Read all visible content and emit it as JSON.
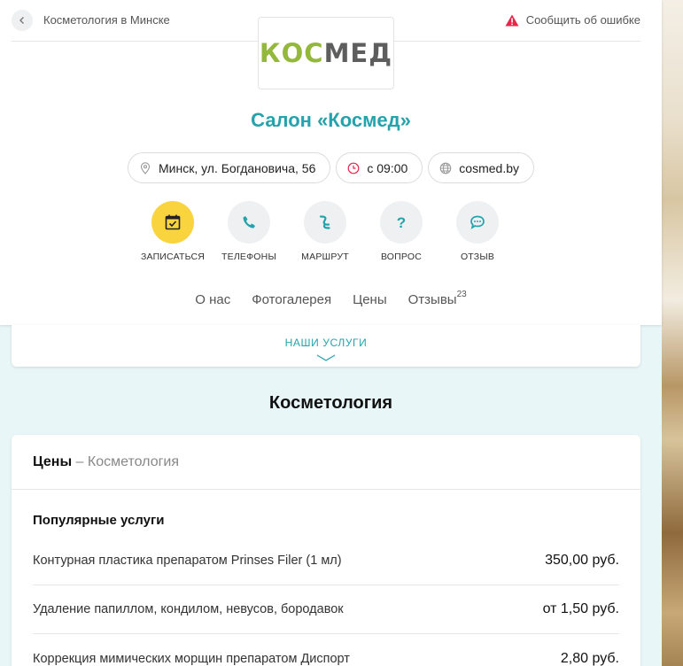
{
  "header": {
    "breadcrumb": "Косметология в Минске",
    "report_label": "Сообщить об ошибке"
  },
  "logo": {
    "part1": "КОС",
    "part2": "МЕД"
  },
  "salon": {
    "title": "Салон «Космед»"
  },
  "info_pills": {
    "address": "Минск, ул. Богдановича, 56",
    "hours": "с 09:00",
    "website": "cosmed.by"
  },
  "actions": {
    "book": "ЗАПИСАТЬСЯ",
    "phones": "ТЕЛЕФОНЫ",
    "route": "МАРШРУТ",
    "question": "ВОПРОС",
    "review": "ОТЗЫВ"
  },
  "tabs": {
    "about": "О нас",
    "gallery": "Фотогалерея",
    "prices": "Цены",
    "reviews": "Отзывы",
    "reviews_count": "23"
  },
  "services": {
    "label": "НАШИ УСЛУГИ"
  },
  "section": {
    "title": "Косметология"
  },
  "prices": {
    "head_bold": "Цены",
    "head_rest": " – Косметология",
    "popular_heading": "Популярные услуги",
    "rows": [
      {
        "name": "Контурная пластика препаратом Prinses Filer (1 мл)",
        "price": "350,00 руб."
      },
      {
        "name": "Удаление папиллом, кондилом, невусов, бородавок",
        "price": "от 1,50 руб."
      },
      {
        "name": "Коррекция мимических морщин препаратом Диспорт",
        "price": "2,80 руб."
      }
    ]
  },
  "colors": {
    "accent": "#25a3ad",
    "action_highlight": "#f9d43e",
    "logo_green": "#94b83b",
    "logo_gray": "#5e5e5e",
    "warning": "#e8264b"
  }
}
